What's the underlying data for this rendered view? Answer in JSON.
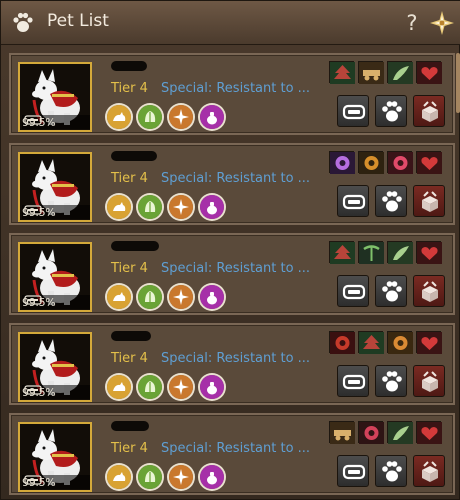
{
  "window": {
    "title": "Pet List",
    "help_label": "?",
    "icons": {
      "title": "paw-icon",
      "settings": "settings-star-icon"
    }
  },
  "colors": {
    "tier": "#e4c04a",
    "special": "#5f9fd3",
    "portrait_border": "#d4a93a",
    "card_bg": "#5a4a3a"
  },
  "pets": [
    {
      "hunger": "99.5%",
      "tier": "Tier 4",
      "special": "Special: Resistant to ...",
      "skills": [
        "cat-icon",
        "leaf-hand-icon",
        "compass-icon",
        "pouch-icon"
      ],
      "traits": [
        "tree-icon",
        "cart-icon",
        "wing-icon",
        "heart-icon"
      ]
    },
    {
      "hunger": "99.5%",
      "tier": "Tier 4",
      "special": "Special: Resistant to ...",
      "skills": [
        "cat-icon",
        "leaf-hand-icon",
        "compass-icon",
        "pouch-icon"
      ],
      "traits": [
        "mage-icon",
        "horse-icon",
        "potion-icon",
        "heart-icon"
      ]
    },
    {
      "hunger": "99.5%",
      "tier": "Tier 4",
      "special": "Special: Resistant to ...",
      "skills": [
        "cat-icon",
        "leaf-hand-icon",
        "compass-icon",
        "pouch-icon"
      ],
      "traits": [
        "tree-icon",
        "pickaxe-icon",
        "wing-icon",
        "heart-icon"
      ]
    },
    {
      "hunger": "99.5%",
      "tier": "Tier 4",
      "special": "Special: Resistant to ...",
      "skills": [
        "cat-icon",
        "leaf-hand-icon",
        "compass-icon",
        "pouch-icon"
      ],
      "traits": [
        "shield-icon",
        "tree-icon",
        "bag-icon",
        "heart-icon"
      ]
    },
    {
      "hunger": "99.5%",
      "tier": "Tier 4",
      "special": "Special: Resistant to ...",
      "skills": [
        "cat-icon",
        "leaf-hand-icon",
        "compass-icon",
        "pouch-icon"
      ],
      "traits": [
        "cart-icon",
        "boot-icon",
        "wing-icon",
        "heart-icon"
      ]
    }
  ],
  "actions": [
    "feed-bowl-icon",
    "paw-print-icon",
    "release-box-icon"
  ]
}
